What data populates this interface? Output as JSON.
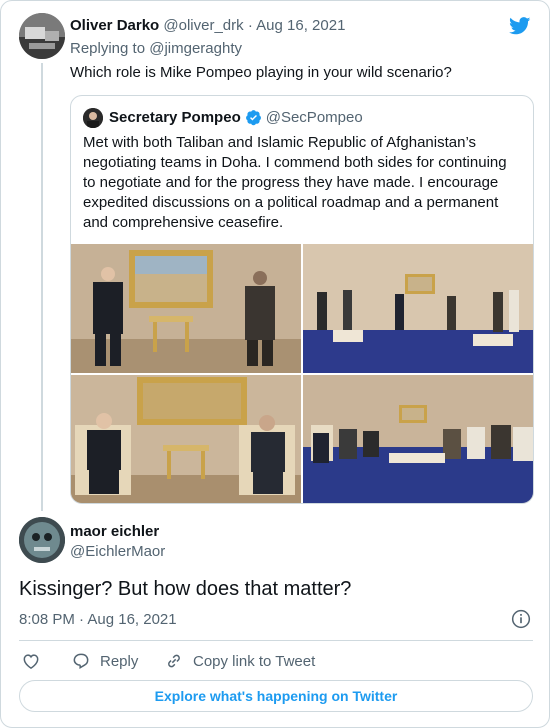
{
  "reply_tweet": {
    "author_name": "Oliver Darko",
    "author_handle": "@oliver_drk",
    "separator": "·",
    "date": "Aug 16, 2021",
    "replying_prefix": "Replying to",
    "replying_handle": "@jimgeraghty",
    "text": "Which role is Mike Pompeo playing in your wild scenario?"
  },
  "quoted_tweet": {
    "author_name": "Secretary Pompeo",
    "author_handle": "@SecPompeo",
    "text": "Met with both Taliban and Islamic Republic of Afghanistan’s negotiating teams in Doha. I commend both sides for continuing to negotiate and for the progress they have made. I encourage expedited discussions on a political roadmap and a permanent and comprehensive ceasefire.",
    "photos": [
      "photo-1",
      "photo-2",
      "photo-3",
      "photo-4"
    ]
  },
  "main_tweet": {
    "author_name": "maor eichler",
    "author_handle": "@EichlerMaor",
    "text": "Kissinger? But how does that matter?",
    "timestamp": "8:08 PM · Aug 16, 2021"
  },
  "actions": {
    "reply_label": "Reply",
    "copy_link_label": "Copy link to Tweet"
  },
  "explore_label": "Explore what's happening on Twitter",
  "colors": {
    "twitter_blue": "#1d9bf0",
    "muted_text": "#536471",
    "border": "#cfd9de"
  },
  "icons": [
    "twitter-bird-icon",
    "verified-badge-icon",
    "info-icon",
    "like-heart-icon",
    "reply-icon",
    "link-icon"
  ]
}
